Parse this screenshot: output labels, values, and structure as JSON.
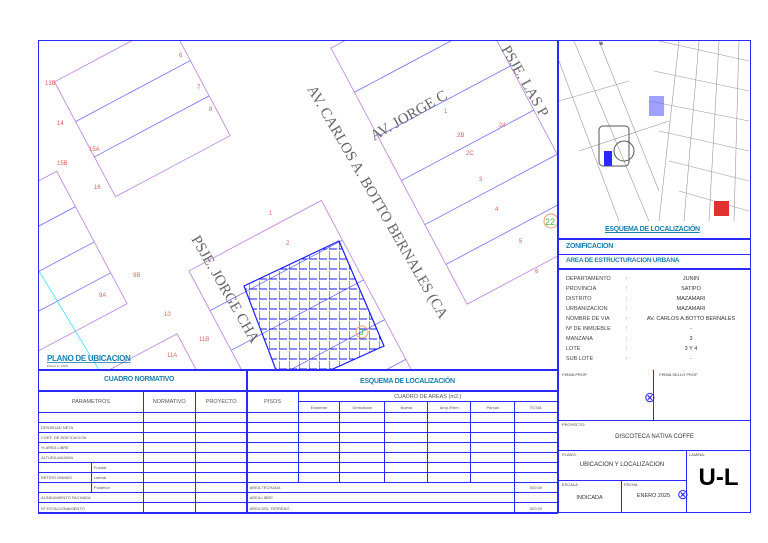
{
  "plan": {
    "title": "PLANO DE UBICACION",
    "scale": "ESCALA: 1/500",
    "streets": {
      "av_jorge": "AV. JORGE C",
      "av_carlos": "AV. CARLOS A. BOTTO BERNALES (CA",
      "psje_las": "PSJE. LAS P",
      "psje_jorge": "PSJE. JORGE CHA"
    },
    "lots": [
      "6",
      "7",
      "8",
      "13B",
      "14",
      "15B",
      "15A",
      "16",
      "1",
      "2",
      "3",
      "4",
      "5",
      "9A",
      "9B",
      "10",
      "11A",
      "11B",
      "1",
      "2B",
      "2C",
      "24",
      "3",
      "4",
      "5",
      "6"
    ],
    "markers": [
      "3",
      "22"
    ]
  },
  "location": {
    "title": "ESQUEMA DE LOCALIZACIÓN"
  },
  "zoning": {
    "title": "ZONIFICACION",
    "subtitle": "AREA DE ESTRUCTURACION URBANA",
    "rows": [
      {
        "label": "DEPARTAMENTO",
        "value": "JUNIN"
      },
      {
        "label": "PROVINCIA",
        "value": "SATIPO"
      },
      {
        "label": "DISTRITO",
        "value": "MAZAMARI"
      },
      {
        "label": "URBANIZACION",
        "value": "MAZAMARI"
      },
      {
        "label": "NOMBRE DE VIA",
        "value": "AV. CARLOS A.BOTTO BERNALES"
      },
      {
        "label": "Nº DE INMUEBLE",
        "value": "-"
      },
      {
        "label": "MANZANA",
        "value": "3"
      },
      {
        "label": "LOTE",
        "value": "3 Y 4"
      },
      {
        "label": "SUB LOTE",
        "value": "-"
      }
    ],
    "sep": ":"
  },
  "normativo": {
    "title": "CUADRO NORMATIVO",
    "headers": [
      "PARAMETROS",
      "NORMATIVO",
      "PROYECTO"
    ],
    "rows": [
      "DENSIDAD NETA",
      "COEF. DE EDIFICACION",
      "% AREA LIBRE",
      "ALTURA MAXIMA"
    ],
    "retiro": "RETIRO MINIMO",
    "retiro_sub": [
      "Frontal",
      "Lateral",
      "Posterior"
    ],
    "alineamiento": "ALINEAMIENTO FACHADA",
    "estacionamiento": "Nº ESTACIONAMIENTO"
  },
  "areas": {
    "title": "ESQUEMA DE LOCALIZACIÓN",
    "pisos": "PISOS",
    "cuadro": "CUADRO DE AREAS (m2.)",
    "cols": [
      "Existente",
      "Demolicion",
      "Nueva",
      "Amp./Rem",
      "Parcial",
      "TOTAL"
    ],
    "techada": "AREA TECHADA",
    "techada_val": "000.00",
    "libre": "AREA LIBRE",
    "libre_val": "-",
    "terreno": "AREA DEL TERRENO",
    "terreno_val": "000.00"
  },
  "titleblock": {
    "firma_prop": "FIRMA PROP.",
    "firma_prof": "FIRMA SELLO PROF.",
    "proyecto_lbl": "PROYECTO:",
    "proyecto": "DISCOTECA NATIVA COFFE",
    "plano_lbl": "PLANO:",
    "plano": "UBICACION Y LOCALIZACION",
    "lamina_lbl": "LAMINA:",
    "lamina": "U-L",
    "escala_lbl": "ESCALA",
    "escala": "INDICADA",
    "fecha_lbl": "FECHA",
    "fecha": "ENERO 2025"
  }
}
